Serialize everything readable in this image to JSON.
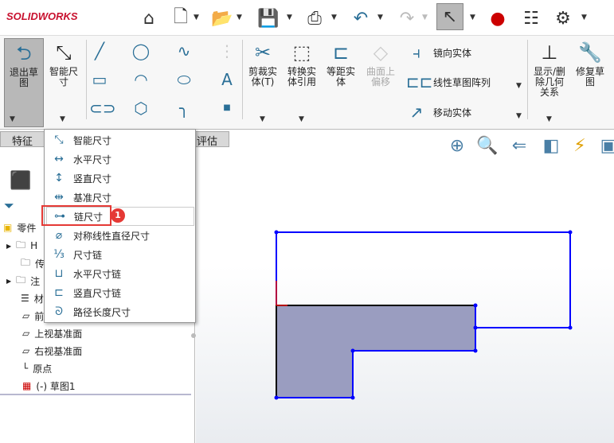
{
  "app": {
    "logo": "SOLIDWORKS"
  },
  "toolbar": {
    "icons": [
      "home-icon",
      "new-document-icon",
      "open-icon",
      "save-icon",
      "print-icon",
      "undo-icon",
      "redo-icon",
      "select-icon",
      "traffic-light-icon",
      "file-properties-icon",
      "options-gear-icon"
    ]
  },
  "ribbon": {
    "exit_sketch": "退出草图",
    "smart_dim": "智能尺寸",
    "trim": "剪裁实体(T)",
    "convert": "转换实体引用",
    "offset": "等距实体",
    "offset_surface": "曲面上偏移",
    "mirror": "镜向实体",
    "linear_pattern": "线性草图阵列",
    "move": "移动实体",
    "relations": "显示/删除几何关系",
    "repair": "修复草图"
  },
  "tabs": {
    "features": "特征",
    "evaluate": "评估"
  },
  "menu": {
    "items": [
      "智能尺寸",
      "水平尺寸",
      "竖直尺寸",
      "基准尺寸",
      "链尺寸",
      "对称线性直径尺寸",
      "尺寸链",
      "水平尺寸链",
      "竖直尺寸链",
      "路径长度尺寸"
    ],
    "highlighted": "链尺寸",
    "badge": "1"
  },
  "tree": {
    "root": "零件",
    "items": [
      "H",
      "传",
      "注",
      "材",
      "前",
      "上视基准面",
      "右视基准面",
      "原点",
      "(-) 草图1"
    ]
  },
  "colors": {
    "accent": "#2a6f97",
    "sketch": "#0000ff",
    "highlight": "#e53935",
    "fill": "#9a9dc0"
  }
}
